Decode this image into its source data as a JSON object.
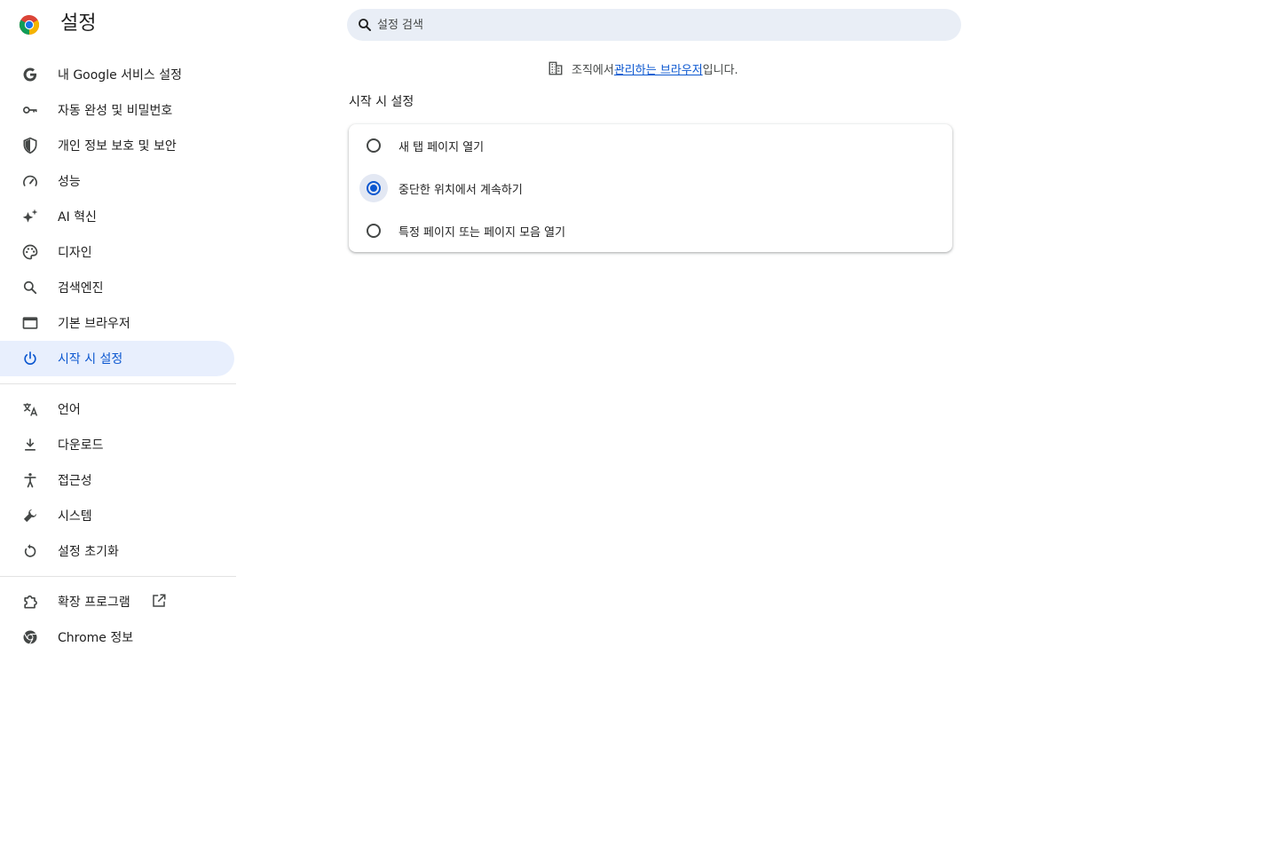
{
  "header": {
    "title": "설정",
    "search_placeholder": "설정 검색"
  },
  "sidebar": {
    "items": [
      {
        "label": "내 Google 서비스 설정",
        "icon": "google-g-icon"
      },
      {
        "label": "자동 완성 및 비밀번호",
        "icon": "key-icon"
      },
      {
        "label": "개인 정보 보호 및 보안",
        "icon": "shield-icon"
      },
      {
        "label": "성능",
        "icon": "speedometer-icon"
      },
      {
        "label": "AI 혁신",
        "icon": "sparkle-icon"
      },
      {
        "label": "디자인",
        "icon": "palette-icon"
      },
      {
        "label": "검색엔진",
        "icon": "search-icon"
      },
      {
        "label": "기본 브라우저",
        "icon": "browser-window-icon"
      },
      {
        "label": "시작 시 설정",
        "icon": "power-icon",
        "active": true
      }
    ],
    "advanced": [
      {
        "label": "언어",
        "icon": "translate-icon"
      },
      {
        "label": "다운로드",
        "icon": "download-icon"
      },
      {
        "label": "접근성",
        "icon": "accessibility-icon"
      },
      {
        "label": "시스템",
        "icon": "wrench-icon"
      },
      {
        "label": "설정 초기화",
        "icon": "reset-icon"
      }
    ],
    "extras": [
      {
        "label": "확장 프로그램",
        "icon": "puzzle-icon"
      },
      {
        "label": "Chrome 정보",
        "icon": "chrome-icon"
      }
    ]
  },
  "main": {
    "managed_prefix": "조직에서 ",
    "managed_link": "관리하는 브라우저",
    "managed_suffix": "입니다.",
    "section_title": "시작 시 설정",
    "options": [
      {
        "label": "새 탭 페이지 열기",
        "checked": false
      },
      {
        "label": "중단한 위치에서 계속하기",
        "checked": true
      },
      {
        "label": "특정 페이지 또는 페이지 모음 열기",
        "checked": false
      }
    ]
  },
  "colors": {
    "accent": "#0b57d0",
    "active_bg": "#e8effd",
    "search_bg": "#e9eef6",
    "icon": "#444746"
  }
}
